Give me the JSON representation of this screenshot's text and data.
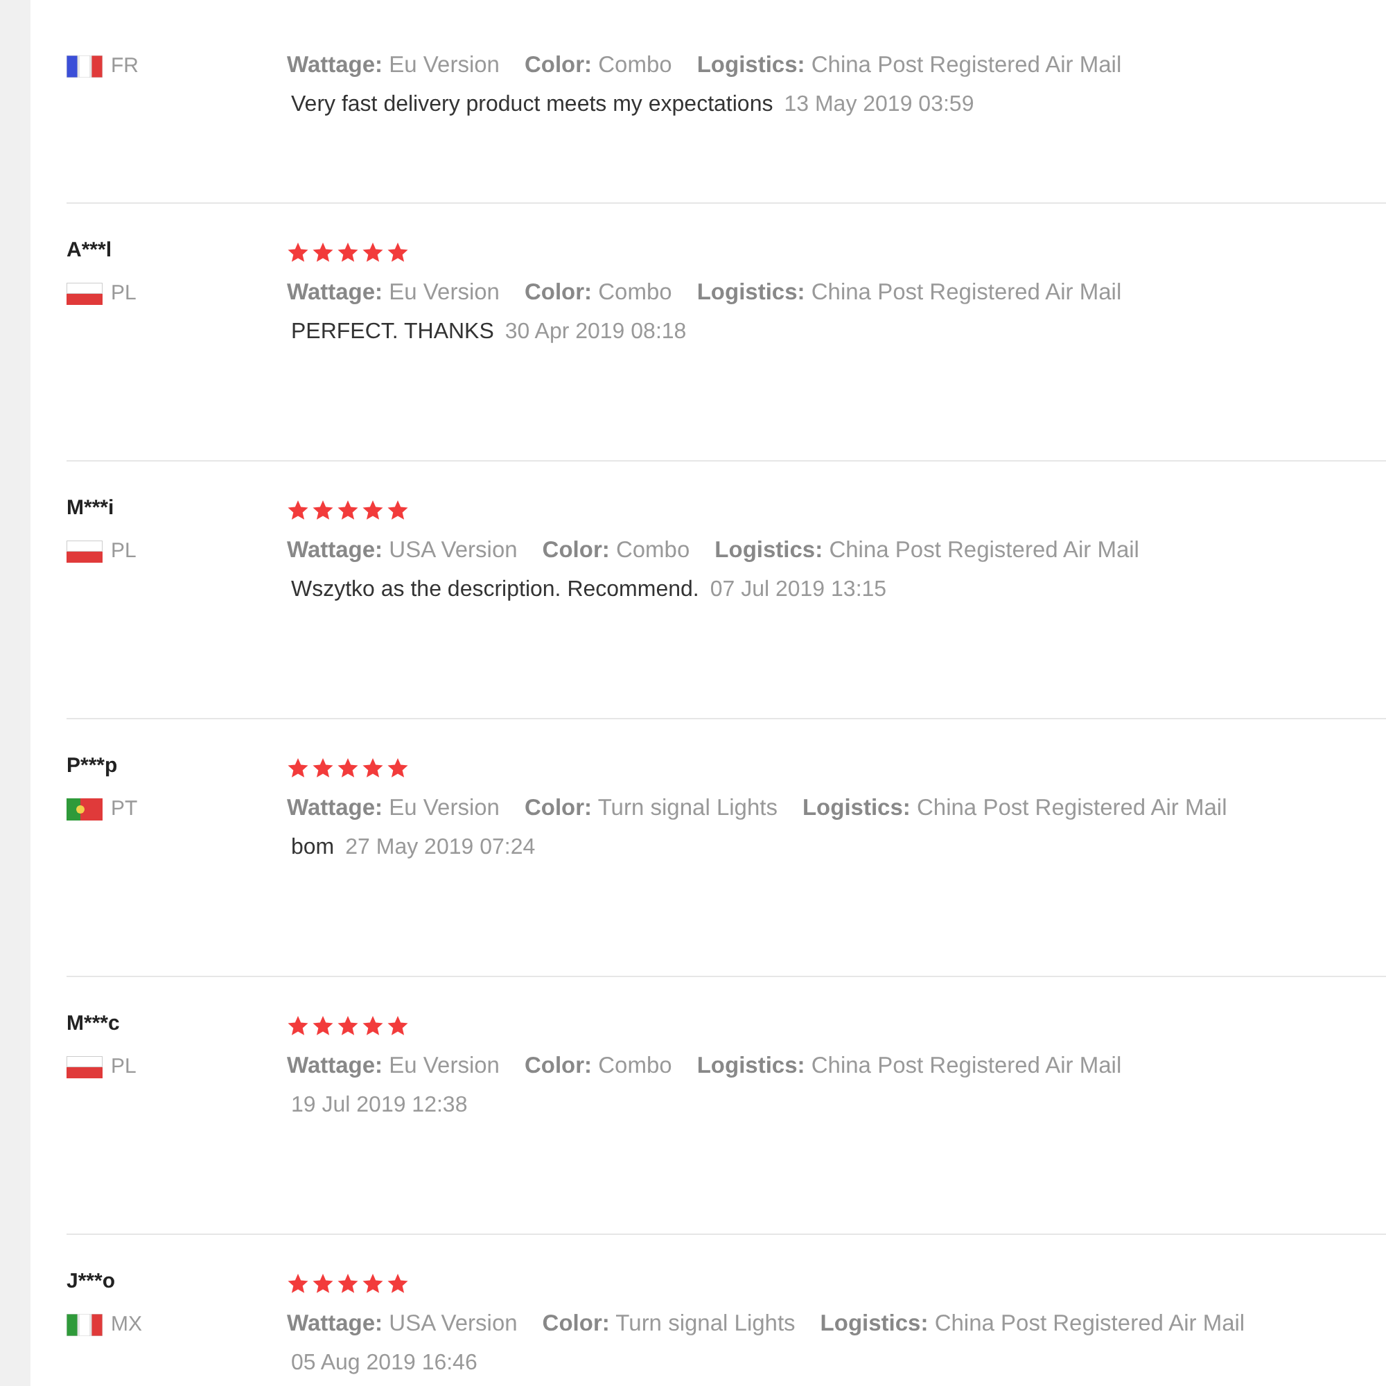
{
  "reviews": [
    {
      "country": "FR",
      "flag": {
        "kind": "fr"
      },
      "attributes": [
        {
          "label": "Wattage:",
          "value": "Eu Version"
        },
        {
          "label": "Color:",
          "value": "Combo"
        },
        {
          "label": "Logistics:",
          "value": "China Post Registered Air Mail"
        }
      ],
      "text": "Very fast delivery product meets my expectations",
      "date": "13 May 2019 03:59"
    },
    {
      "name": "A***l",
      "country": "PL",
      "flag": {
        "kind": "pl"
      },
      "stars": 5,
      "attributes": [
        {
          "label": "Wattage:",
          "value": "Eu Version"
        },
        {
          "label": "Color:",
          "value": "Combo"
        },
        {
          "label": "Logistics:",
          "value": "China Post Registered Air Mail"
        }
      ],
      "text": "PERFECT. THANKS",
      "date": "30 Apr 2019 08:18"
    },
    {
      "name": "M***i",
      "country": "PL",
      "flag": {
        "kind": "pl"
      },
      "stars": 5,
      "attributes": [
        {
          "label": "Wattage:",
          "value": "USA Version"
        },
        {
          "label": "Color:",
          "value": "Combo"
        },
        {
          "label": "Logistics:",
          "value": "China Post Registered Air Mail"
        }
      ],
      "text": "Wszytko as the description. Recommend.",
      "date": "07 Jul 2019 13:15"
    },
    {
      "name": "P***p",
      "country": "PT",
      "flag": {
        "kind": "pt"
      },
      "stars": 5,
      "attributes": [
        {
          "label": "Wattage:",
          "value": "Eu Version"
        },
        {
          "label": "Color:",
          "value": "Turn signal Lights"
        },
        {
          "label": "Logistics:",
          "value": "China Post Registered Air Mail"
        }
      ],
      "text": "bom",
      "date": "27 May 2019 07:24"
    },
    {
      "name": "M***c",
      "country": "PL",
      "flag": {
        "kind": "pl"
      },
      "stars": 5,
      "attributes": [
        {
          "label": "Wattage:",
          "value": "Eu Version"
        },
        {
          "label": "Color:",
          "value": "Combo"
        },
        {
          "label": "Logistics:",
          "value": "China Post Registered Air Mail"
        }
      ],
      "date": "19 Jul 2019 12:38"
    },
    {
      "name": "J***o",
      "country": "MX",
      "flag": {
        "kind": "mx"
      },
      "stars": 5,
      "attributes": [
        {
          "label": "Wattage:",
          "value": "USA Version"
        },
        {
          "label": "Color:",
          "value": "Turn signal Lights"
        },
        {
          "label": "Logistics:",
          "value": "China Post Registered Air Mail"
        }
      ],
      "date": "05 Aug 2019 16:46"
    }
  ]
}
